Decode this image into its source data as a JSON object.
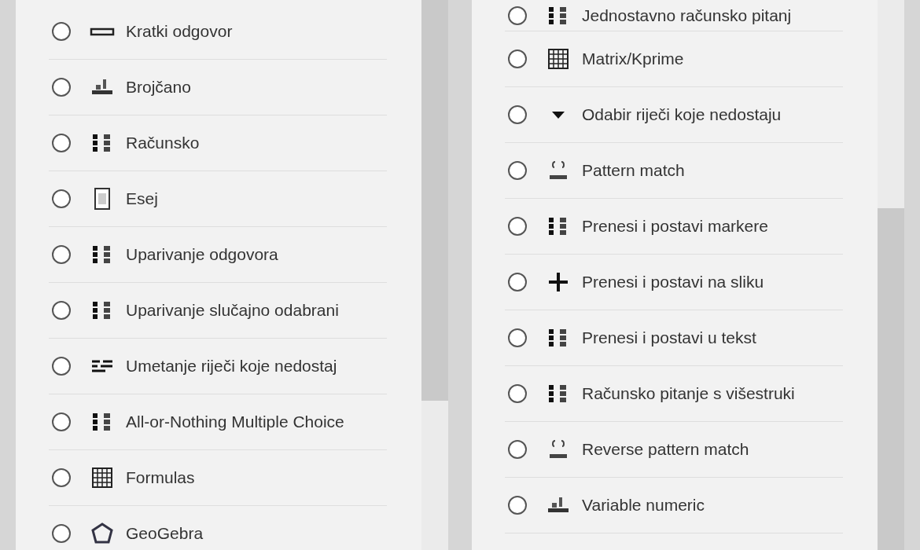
{
  "left_panel": {
    "items": [
      {
        "label": "Kratki odgovor",
        "kind": "shortanswer",
        "selected": false
      },
      {
        "label": "Brojčano",
        "kind": "numerical",
        "selected": false
      },
      {
        "label": "Računsko",
        "kind": "calculated",
        "selected": false
      },
      {
        "label": "Esej",
        "kind": "essay",
        "selected": false
      },
      {
        "label": "Uparivanje odgovora",
        "kind": "match",
        "selected": false
      },
      {
        "label": "Uparivanje slučajno odabrani",
        "kind": "randomsamatch",
        "selected": false
      },
      {
        "label": "Umetanje riječi koje nedostaj",
        "kind": "gapfill",
        "selected": false
      },
      {
        "label": "All-or-Nothing Multiple Choice",
        "kind": "multichoiceset",
        "selected": false
      },
      {
        "label": "Formulas",
        "kind": "formulas",
        "selected": false
      },
      {
        "label": "GeoGebra",
        "kind": "geogebra",
        "selected": false
      }
    ]
  },
  "right_panel": {
    "items": [
      {
        "label": "Jednostavno računsko pitanj",
        "kind": "calculatedsimple",
        "selected": false
      },
      {
        "label": "Matrix/Kprime",
        "kind": "matrix",
        "selected": false
      },
      {
        "label": "Odabir riječi koje nedostaju",
        "kind": "gapselect",
        "selected": false
      },
      {
        "label": "Pattern match",
        "kind": "pmatch",
        "selected": false
      },
      {
        "label": "Prenesi i postavi markere",
        "kind": "ddmarker",
        "selected": false
      },
      {
        "label": "Prenesi i postavi na sliku",
        "kind": "ddimage",
        "selected": false
      },
      {
        "label": "Prenesi i postavi u tekst",
        "kind": "ddwtos",
        "selected": false
      },
      {
        "label": "Računsko pitanje s višestruki",
        "kind": "calculatedmulti",
        "selected": false
      },
      {
        "label": "Reverse pattern match",
        "kind": "pmatchreverse",
        "selected": false
      },
      {
        "label": "Variable numeric",
        "kind": "varnumeric",
        "selected": false
      }
    ]
  }
}
